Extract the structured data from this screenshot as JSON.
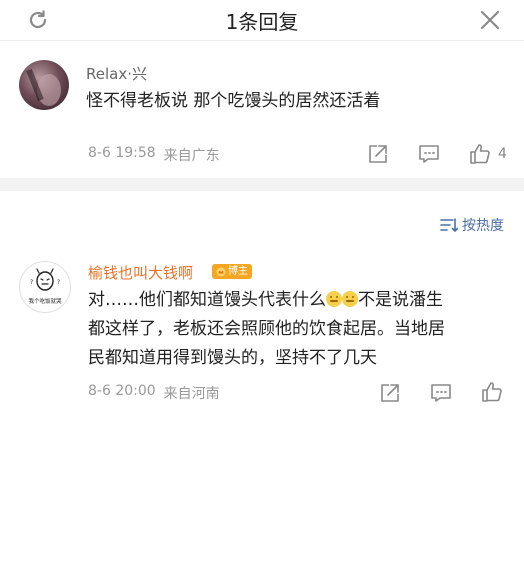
{
  "header": {
    "title": "1条回复"
  },
  "comment1": {
    "username": "Relax·兴",
    "content": "怪不得老板说 那个吃馒头的居然还活着",
    "date": "8-6 19:58",
    "source": "来自广东",
    "likes": "4"
  },
  "sort": {
    "label": "按热度"
  },
  "comment2": {
    "username": "榆钱也叫大钱啊",
    "badge": "博主",
    "avatar_text": "我个吃饭就哭",
    "content_part1": "对……他们都知道馒头代表什么",
    "content_part2": "不是说潘生",
    "content_line2": "都这样了，老板还会照顾他的饮食起居。当地居",
    "content_line3": "民都知道用得到馒头的，坚持不了几天",
    "date": "8-6 20:00",
    "source": "来自河南"
  },
  "colors": {
    "username_gray": "#666666",
    "username_orange": "#e8732a",
    "badge": "#f5a623",
    "link_blue": "#4a6fa5"
  }
}
